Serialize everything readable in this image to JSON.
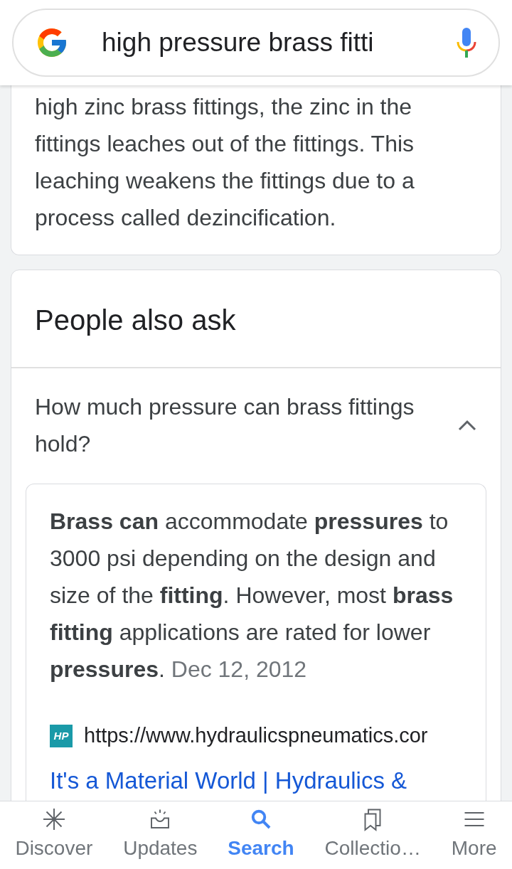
{
  "search": {
    "value": "high pressure brass fitti"
  },
  "snippet": {
    "text": "high zinc brass fittings, the zinc in the fittings leaches out of the fittings. This leaching weakens the fittings due to a process called dezincification."
  },
  "people_also_ask": {
    "title": "People also ask",
    "questions": [
      {
        "question": "How much pressure can brass fittings hold?",
        "expanded": true,
        "answer": "**Brass can** accommodate **pressures** to 3000 psi depending on the design and size of the **fitting**. However, most **brass fitting** applications are rated for lower **pressures**.",
        "date": "Dec 12, 2012",
        "url": "https://www.hydraulicspneumatics.cor",
        "favicon": "HP",
        "link": "It's a Material World | Hydraulics &"
      }
    ]
  },
  "nav": [
    {
      "label": "Discover",
      "kind": "discover",
      "selected": false
    },
    {
      "label": "Updates",
      "kind": "updates",
      "selected": false
    },
    {
      "label": "Search",
      "kind": "search",
      "selected": true
    },
    {
      "label": "Collectio…",
      "kind": "collections",
      "selected": false
    },
    {
      "label": "More",
      "kind": "more",
      "selected": false
    }
  ]
}
